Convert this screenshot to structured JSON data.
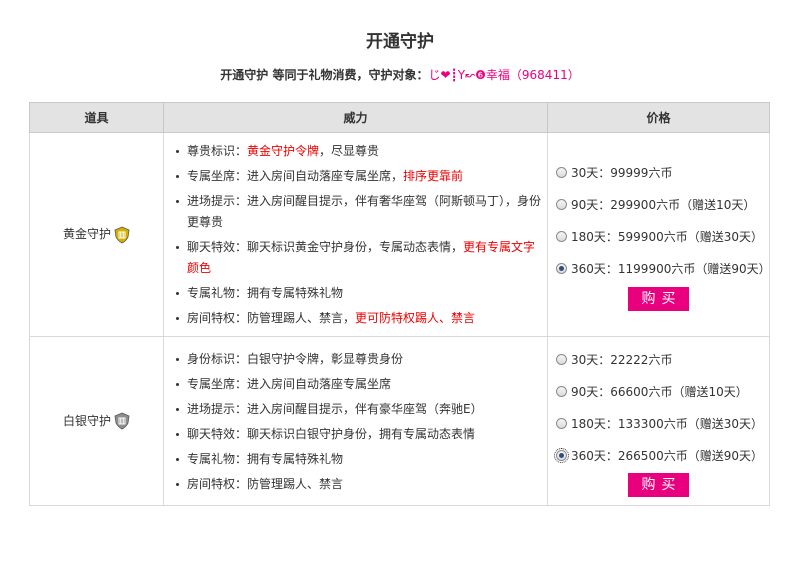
{
  "title": "开通守护",
  "subtitle": {
    "prefix": "开通守护 等同于礼物消费，守护对象：",
    "target_name": "じ❤┋Y↜❻幸福",
    "target_id": "968411"
  },
  "table": {
    "headers": [
      "道具",
      "威力",
      "价格"
    ],
    "rows": [
      {
        "item": "黄金守护",
        "badge_color": "#d4b000",
        "powers": [
          {
            "label": "尊贵标识：",
            "segments": [
              {
                "text": "黄金守护令牌",
                "red": true
              },
              {
                "text": "，尽显尊贵",
                "red": false
              }
            ]
          },
          {
            "label": "专属坐席：",
            "segments": [
              {
                "text": "进入房间自动落座专属坐席，",
                "red": false
              },
              {
                "text": "排序更靠前",
                "red": true
              }
            ]
          },
          {
            "label": "进场提示：",
            "segments": [
              {
                "text": "进入房间醒目提示，伴有奢华座驾（阿斯顿马丁），身份更尊贵",
                "red": false
              }
            ]
          },
          {
            "label": "聊天特效：",
            "segments": [
              {
                "text": "聊天标识黄金守护身份，专属动态表情，",
                "red": false
              },
              {
                "text": "更有专属文字颜色",
                "red": true
              }
            ]
          },
          {
            "label": "专属礼物：",
            "segments": [
              {
                "text": "拥有专属特殊礼物",
                "red": false
              }
            ]
          },
          {
            "label": "房间特权：",
            "segments": [
              {
                "text": "防管理踢人、禁言，",
                "red": false
              },
              {
                "text": "更可防特权踢人、禁言",
                "red": true
              }
            ]
          }
        ],
        "prices": [
          {
            "label": "30天：99999六币",
            "checked": false
          },
          {
            "label": "90天：299900六币（赠送10天）",
            "checked": false
          },
          {
            "label": "180天：599900六币（赠送30天）",
            "checked": false
          },
          {
            "label": "360天：1199900六币（赠送90天）",
            "checked": true
          }
        ],
        "buy_label": "购买"
      },
      {
        "item": "白银守护",
        "badge_color": "#8e8e8e",
        "powers": [
          {
            "label": "身份标识：",
            "segments": [
              {
                "text": "白银守护令牌，彰显尊贵身份",
                "red": false
              }
            ]
          },
          {
            "label": "专属坐席：",
            "segments": [
              {
                "text": "进入房间自动落座专属坐席",
                "red": false
              }
            ]
          },
          {
            "label": "进场提示：",
            "segments": [
              {
                "text": "进入房间醒目提示，伴有豪华座驾（奔驰E）",
                "red": false
              }
            ]
          },
          {
            "label": "聊天特效：",
            "segments": [
              {
                "text": "聊天标识白银守护身份，拥有专属动态表情",
                "red": false
              }
            ]
          },
          {
            "label": "专属礼物：",
            "segments": [
              {
                "text": "拥有专属特殊礼物",
                "red": false
              }
            ]
          },
          {
            "label": "房间特权：",
            "segments": [
              {
                "text": "防管理踢人、禁言",
                "red": false
              }
            ]
          }
        ],
        "prices": [
          {
            "label": "30天：22222六币",
            "checked": false
          },
          {
            "label": "90天：66600六币（赠送10天）",
            "checked": false
          },
          {
            "label": "180天：133300六币（赠送30天）",
            "checked": false
          },
          {
            "label": "360天：266500六币（赠送90天）",
            "checked": true,
            "focused": true
          }
        ],
        "buy_label": "购买"
      }
    ]
  }
}
